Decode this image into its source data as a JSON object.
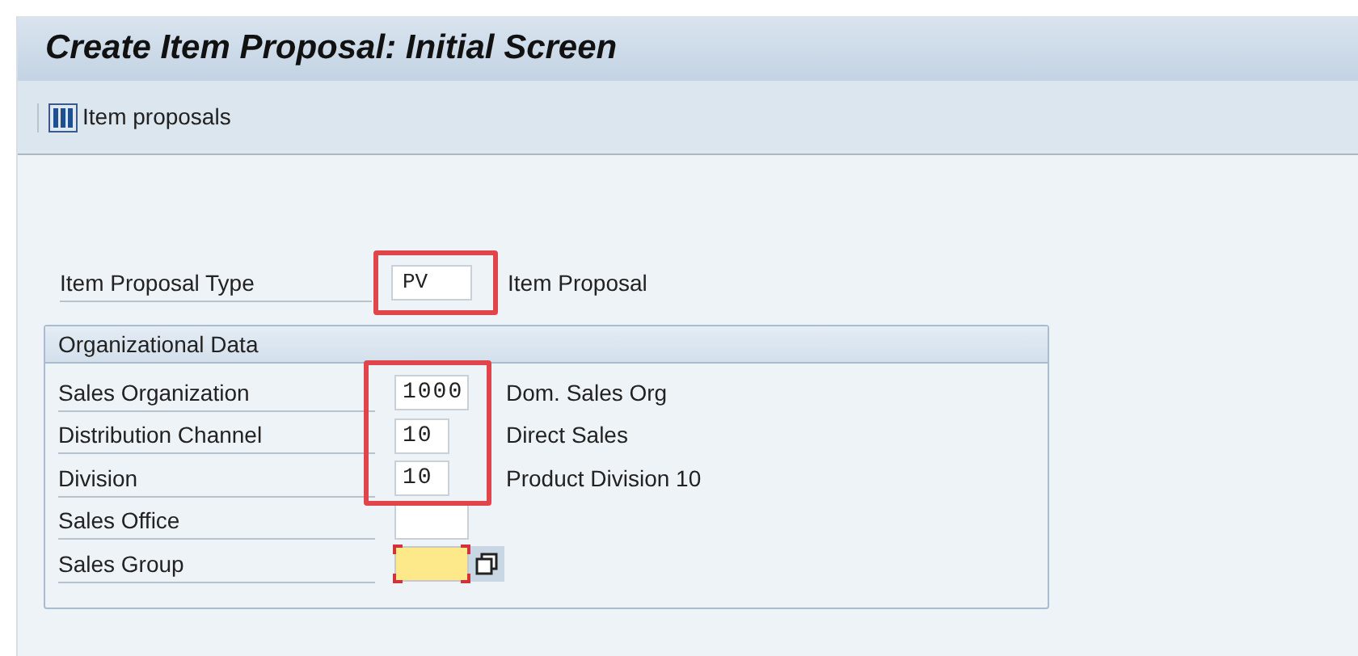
{
  "window": {
    "title": "Create Item Proposal: Initial Screen"
  },
  "toolbar": [
    {
      "label": "Item proposals"
    }
  ],
  "proposal_type": {
    "label": "Item Proposal Type",
    "value": "PV",
    "description": "Item Proposal",
    "highlighted": true
  },
  "org_data": {
    "title": "Organizational Data",
    "rows": [
      {
        "label": "Sales Organization",
        "value": "1000",
        "description": "Dom. Sales Org",
        "highlighted": true,
        "kind": "normal"
      },
      {
        "label": "Distribution Channel",
        "value": "10",
        "description": "Direct Sales",
        "highlighted": true,
        "kind": "normal"
      },
      {
        "label": "Division",
        "value": "10",
        "description": "Product Division 10",
        "highlighted": true,
        "kind": "normal"
      },
      {
        "label": "Sales Office",
        "kind": "normal"
      },
      {
        "label": "Sales Group",
        "kind": "focused",
        "value_help": true
      }
    ]
  }
}
